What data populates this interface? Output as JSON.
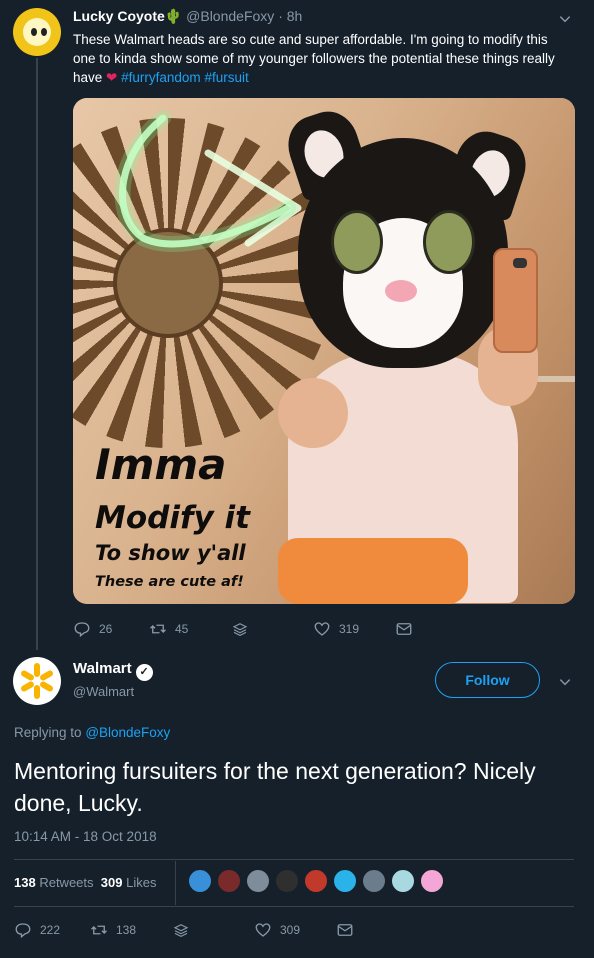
{
  "parent_tweet": {
    "display_name": "Lucky Coyote",
    "name_emoji": "🌵",
    "handle": "@BlondeFoxy",
    "time": "8h",
    "separator": "·",
    "text_before_heart": "These Walmart heads are so cute and super affordable.  I'm going to modify this one to kinda show some of my younger followers the potential these things really have",
    "heart": "❤",
    "hashtags": [
      "#furryfandom",
      "#fursuit"
    ],
    "image_caption": {
      "line1": "Imma",
      "line2": "Modify it",
      "line3": "To show y'all",
      "line4": "These are cute af!"
    },
    "actions": {
      "replies": "26",
      "retweets": "45",
      "likes": "319"
    }
  },
  "reply_tweet": {
    "display_name": "Walmart",
    "verified_mark": "✓",
    "handle": "@Walmart",
    "follow_label": "Follow",
    "replying_prefix": "Replying to",
    "replying_handle": "@BlondeFoxy",
    "text": "Mentoring fursuiters for the next generation? Nicely done, Lucky.",
    "timestamp": "10:14 AM - 18 Oct 2018",
    "retweets_count": "138",
    "retweets_label": "Retweets",
    "likes_count": "309",
    "likes_label": "Likes",
    "liker_avatar_colors": [
      "#3a8fd9",
      "#7a2a2a",
      "#7f8c99",
      "#2f2f2f",
      "#c0392b",
      "#2ab3e8",
      "#6b7c8c",
      "#a8d8e0",
      "#f4a6d7"
    ],
    "actions": {
      "replies": "222",
      "retweets": "138",
      "likes": "309"
    }
  },
  "icons": {
    "caret": "chevron-down-icon",
    "reply": "reply-icon",
    "retweet": "retweet-icon",
    "stack": "stack-icon",
    "like": "heart-icon",
    "dm": "envelope-icon"
  },
  "colors": {
    "background": "#15202b",
    "accent": "#1da1f2",
    "muted": "#8899a6",
    "walmart_spark": "#f8b400"
  }
}
